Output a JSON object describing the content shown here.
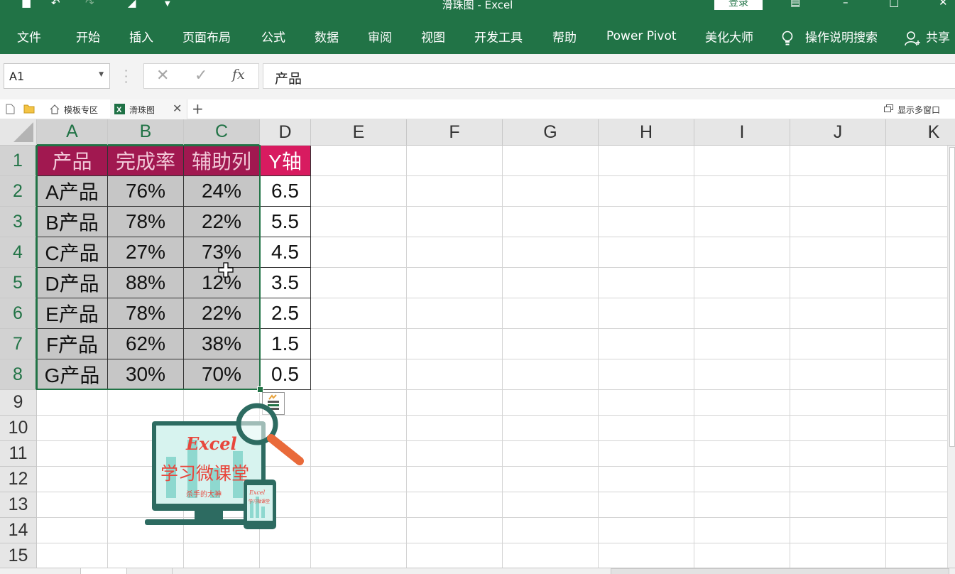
{
  "title": {
    "window_title": "滑珠图  -  Excel",
    "login_label": "登录"
  },
  "ribbon": {
    "tabs": [
      "文件",
      "开始",
      "插入",
      "页面布局",
      "公式",
      "数据",
      "审阅",
      "视图",
      "开发工具",
      "帮助",
      "Power Pivot",
      "美化大师",
      "操作说明搜索",
      "共享"
    ]
  },
  "formula_bar": {
    "name_box": "A1",
    "formula": "产品",
    "fx_label": "fx"
  },
  "doc_tabs": {
    "template_tab": "模板专区",
    "active_tab": "滑珠图",
    "multi_window": "显示多窗口"
  },
  "columns": [
    "A",
    "B",
    "C",
    "D",
    "E",
    "F",
    "G",
    "H",
    "I",
    "J",
    "K"
  ],
  "rows": [
    "1",
    "2",
    "3",
    "4",
    "5",
    "6",
    "7",
    "8",
    "9",
    "10",
    "11",
    "12",
    "13",
    "14",
    "15"
  ],
  "table": {
    "headers": [
      "产品",
      "完成率",
      "辅助列",
      "Y轴"
    ],
    "rows": [
      [
        "A产品",
        "76%",
        "24%",
        "6.5"
      ],
      [
        "B产品",
        "78%",
        "22%",
        "5.5"
      ],
      [
        "C产品",
        "27%",
        "73%",
        "4.5"
      ],
      [
        "D产品",
        "88%",
        "12%",
        "3.5"
      ],
      [
        "E产品",
        "78%",
        "22%",
        "2.5"
      ],
      [
        "F产品",
        "62%",
        "38%",
        "1.5"
      ],
      [
        "G产品",
        "30%",
        "70%",
        "0.5"
      ]
    ]
  },
  "logo": {
    "title": "Excel",
    "subtitle": "学习微课堂",
    "tagline": "杀手的大神",
    "phone_title": "Excel",
    "phone_sub": "学习微课堂"
  },
  "colors": {
    "excel_green": "#217346",
    "header_pink": "#d81b60",
    "selection_gray": "#c6c6c6"
  }
}
